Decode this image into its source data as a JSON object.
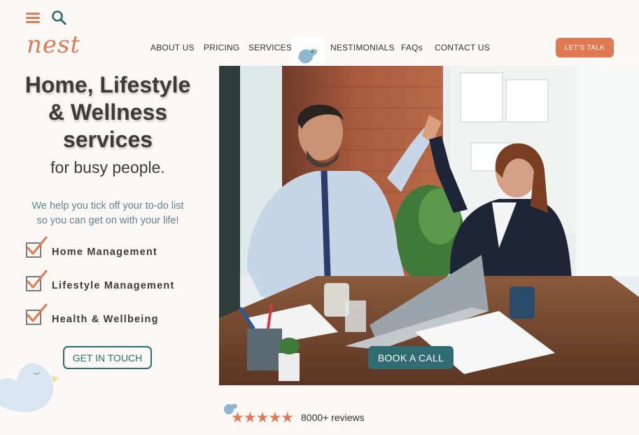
{
  "brand": {
    "logo_text": "nest",
    "accent_color": "#e07a55",
    "teal_color": "#2f6d73"
  },
  "header": {
    "icons": [
      "menu-icon",
      "search-icon"
    ],
    "nav": [
      {
        "label": "ABOUT US"
      },
      {
        "label": "PRICING"
      },
      {
        "label": "SERVICES"
      },
      {
        "label": "NESTIMONIALS"
      },
      {
        "label": "FAQs"
      },
      {
        "label": "CONTACT US"
      }
    ],
    "cta_label": "LET'S TALK"
  },
  "hero": {
    "title_line1": "Home, Lifestyle",
    "title_line2": "& Wellness",
    "title_line3": "services",
    "subtitle": "for busy people.",
    "help_line1": "We help you tick off your to-do list",
    "help_line2": "so you can get on with your life!",
    "checklist": [
      {
        "label": "Home Management"
      },
      {
        "label": "Lifestyle Management"
      },
      {
        "label": "Health & Wellbeing"
      }
    ],
    "get_in_touch_label": "GET IN TOUCH",
    "book_call_label": "BOOK A CALL"
  },
  "reviews": {
    "stars": "★★★★★",
    "rating": 5,
    "count_text": "8000+ reviews"
  }
}
